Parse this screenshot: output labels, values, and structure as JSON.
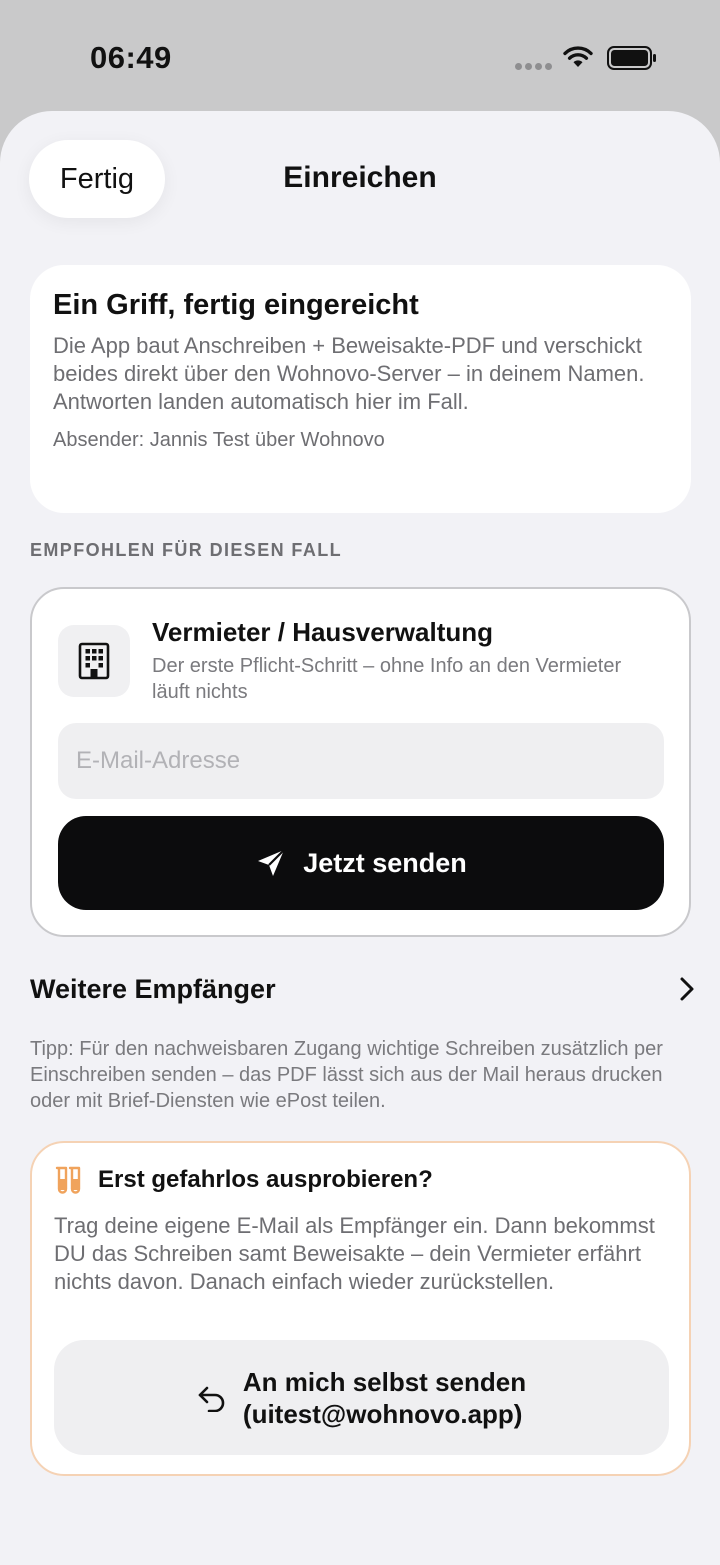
{
  "status": {
    "time": "06:49"
  },
  "nav": {
    "done_label": "Fertig",
    "title": "Einreichen"
  },
  "intro": {
    "title": "Ein Griff, fertig eingereicht",
    "body": "Die App baut Anschreiben + Beweisakte-PDF und verschickt beides direkt über den Wohnovo-Server – in deinem Namen. Antworten landen automatisch hier im Fall.",
    "sender": "Absender: Jannis Test über Wohnovo"
  },
  "recommended": {
    "section_label": "EMPFOHLEN FÜR DIESEN FALL",
    "icon": "building-icon",
    "title": "Vermieter / Hausverwaltung",
    "subtitle": "Der erste Pflicht-Schritt – ohne Info an den Vermieter läuft nichts",
    "email_placeholder": "E-Mail-Adresse",
    "email_value": "",
    "send_label": "Jetzt senden"
  },
  "more_recipients": {
    "label": "Weitere Empfänger"
  },
  "tip": "Tipp: Für den nachweisbaren Zugang wichtige Schreiben zusätzlich per Einschreiben senden – das PDF lässt sich aus der Mail heraus drucken oder mit Brief-Diensten wie ePost teilen.",
  "test": {
    "icon": "test-tubes-icon",
    "title": "Erst gefahrlos ausprobieren?",
    "body": "Trag deine eigene E-Mail als Empfänger ein. Dann bekommst DU das Schreiben samt Beweisakte – dein Vermieter erfährt nichts davon. Danach einfach wieder zurückstellen.",
    "button_line1": "An mich selbst senden",
    "button_line2": "(uitest@wohnovo.app)"
  },
  "colors": {
    "accent_orange": "#f0a35c",
    "send_button": "#0c0c0d",
    "sheet_bg": "#f2f2f6"
  }
}
